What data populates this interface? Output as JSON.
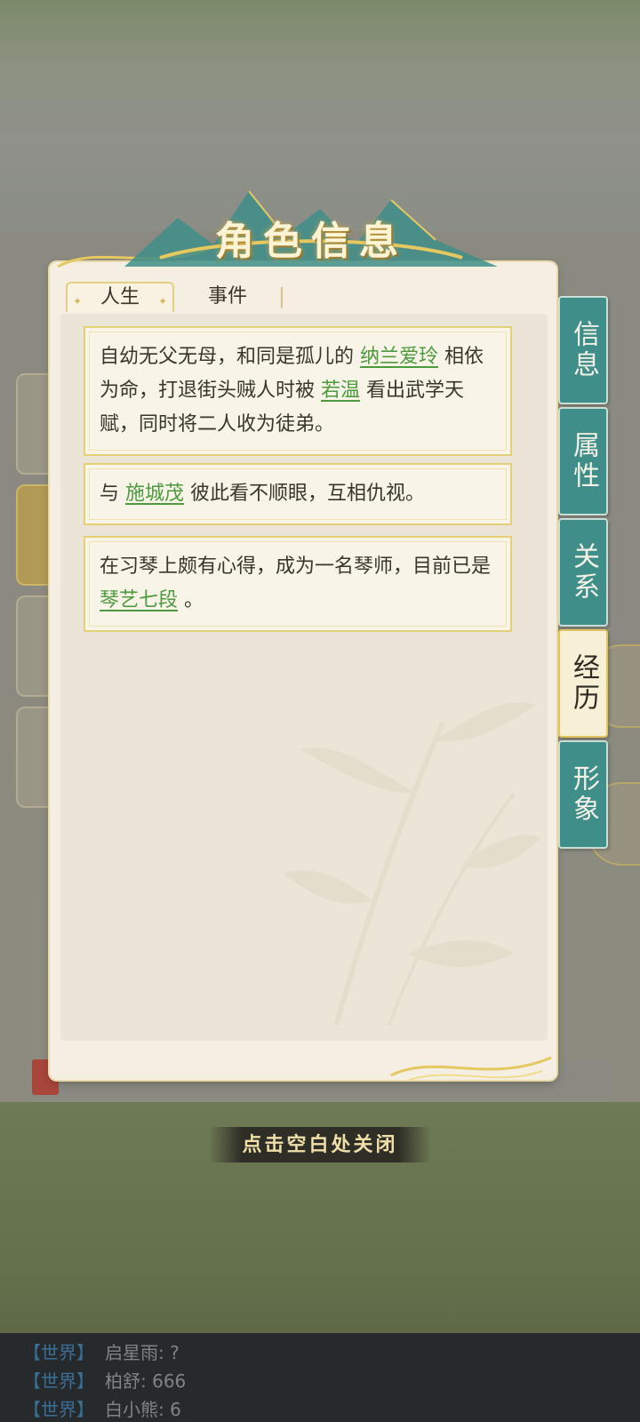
{
  "dialog": {
    "title": "角色信息",
    "tabs": [
      {
        "label": "人生",
        "active": true
      },
      {
        "label": "事件",
        "active": false
      }
    ],
    "side_tabs": [
      {
        "label": "信息",
        "active": false
      },
      {
        "label": "属性",
        "active": false
      },
      {
        "label": "关系",
        "active": false
      },
      {
        "label": "经历",
        "active": true
      },
      {
        "label": "形象",
        "active": false
      }
    ],
    "cards": [
      {
        "parts": [
          {
            "text": "自幼无父无母，和同是孤儿的 "
          },
          {
            "text": "纳兰爱玲",
            "link": true
          },
          {
            "text": " 相依为命，打退街头贼人时被 "
          },
          {
            "text": "若温",
            "link": true
          },
          {
            "text": " 看出武学天赋，同时将二人收为徒弟。"
          }
        ]
      },
      {
        "parts": [
          {
            "text": "与 "
          },
          {
            "text": "施城茂",
            "link": true
          },
          {
            "text": " 彼此看不顺眼，互相仇视。"
          }
        ]
      },
      {
        "parts": [
          {
            "text": "在习琴上颇有心得，成为一名琴师，目前已是 "
          },
          {
            "text": "琴艺七段",
            "link": true
          },
          {
            "text": " 。"
          }
        ]
      }
    ],
    "close_hint": "点击空白处关闭"
  },
  "chat": [
    {
      "channel": "【世界】",
      "message": "启星雨: ?"
    },
    {
      "channel": "【世界】",
      "message": "柏舒: 666"
    },
    {
      "channel": "【世界】",
      "message": "白小熊: 6"
    }
  ],
  "colors": {
    "link": "#4c9a3d",
    "side_tab": "#3f8e8a",
    "card_border": "#e5cf77"
  }
}
